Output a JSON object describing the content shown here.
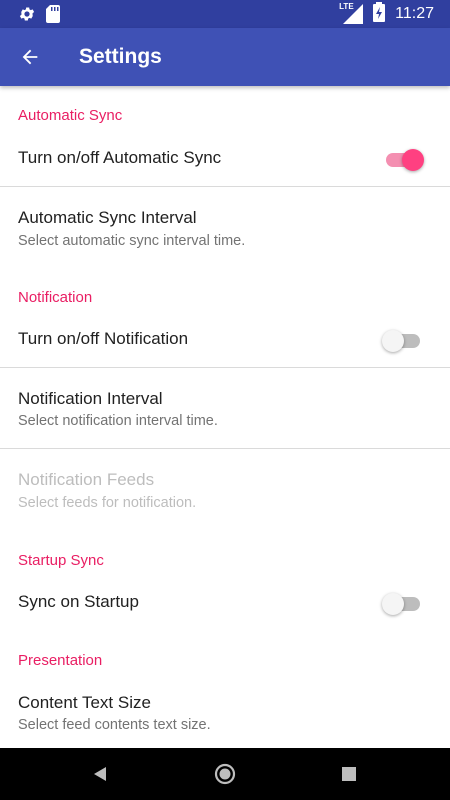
{
  "status_bar": {
    "time": "11:27",
    "network": "LTE",
    "icons": [
      "settings-gear-icon",
      "sd-card-icon",
      "signal-icon",
      "battery-charging-icon"
    ]
  },
  "app_bar": {
    "title": "Settings",
    "back_icon": "arrow-back-icon"
  },
  "sections": {
    "automatic_sync": {
      "header": "Automatic Sync",
      "toggle_title": "Turn on/off Automatic Sync",
      "toggle_on": true,
      "interval_title": "Automatic Sync Interval",
      "interval_summary": "Select automatic sync interval time."
    },
    "notification": {
      "header": "Notification",
      "toggle_title": "Turn on/off Notification",
      "toggle_on": false,
      "interval_title": "Notification Interval",
      "interval_summary": "Select notification interval time.",
      "feeds_title": "Notification Feeds",
      "feeds_summary": "Select feeds for notification.",
      "feeds_enabled": false
    },
    "startup_sync": {
      "header": "Startup Sync",
      "toggle_title": "Sync on Startup",
      "toggle_on": false
    },
    "presentation": {
      "header": "Presentation",
      "text_size_title": "Content Text Size",
      "text_size_summary": "Select feed contents text size."
    }
  },
  "colors": {
    "primary": "#3F51B5",
    "primary_dark": "#303F9F",
    "accent": "#FF4081",
    "category": "#E91E63"
  },
  "nav_bar": {
    "icons": [
      "back-triangle-icon",
      "home-circle-icon",
      "recents-square-icon"
    ]
  }
}
